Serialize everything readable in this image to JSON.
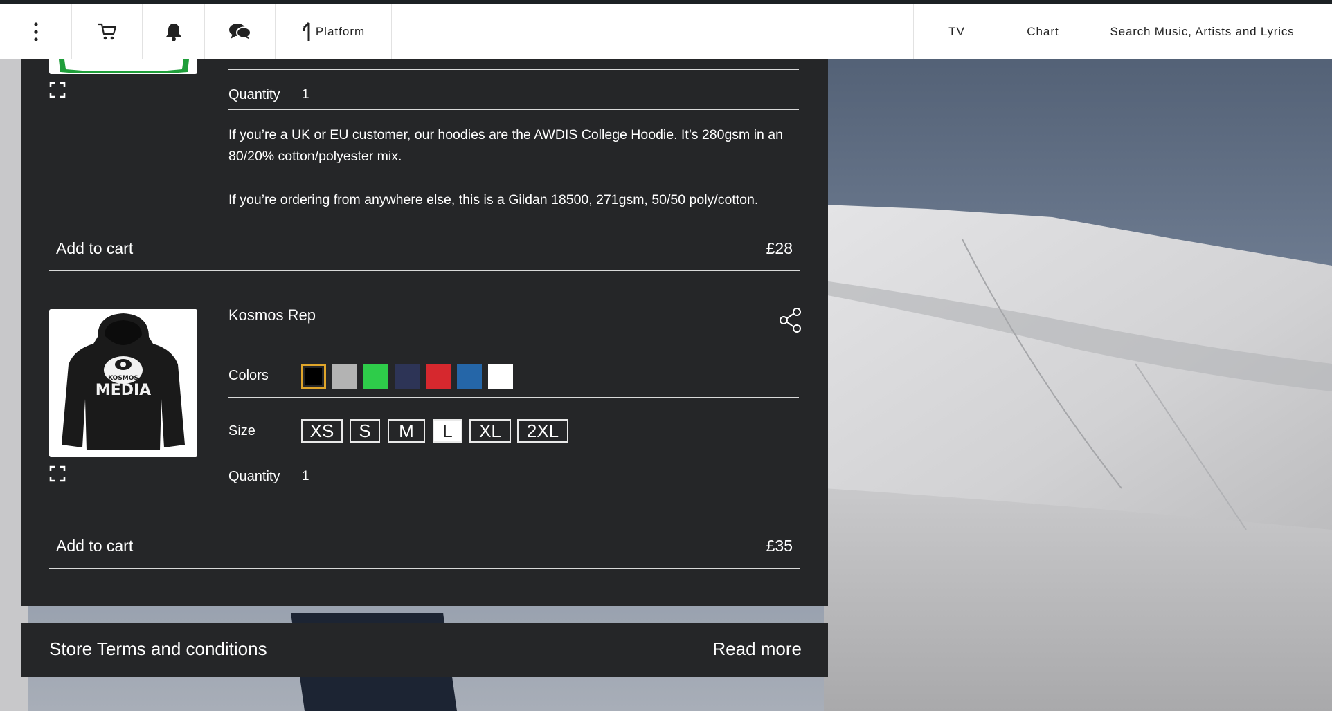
{
  "topbar": {
    "platform_label": "Platform",
    "tv_label": "TV",
    "chart_label": "Chart",
    "search_placeholder": "Search Music, Artists and Lyrics"
  },
  "product_prev": {
    "quantity_label": "Quantity",
    "quantity_value": "1",
    "description_1": "If you’re a UK or EU customer, our hoodies are the AWDIS College Hoodie. It’s 280gsm in an 80/20% cotton/polyester mix.",
    "description_2": "If you’re ordering from anywhere else, this is a Gildan 18500, 271gsm, 50/50 poly/cotton.",
    "add_to_cart": "Add to cart",
    "price": "£28"
  },
  "product": {
    "title": "Kosmos Rep",
    "image_text_top": "KOSMOS",
    "image_text_main": "MEDIA",
    "colors_label": "Colors",
    "colors": [
      "#000000",
      "#b3b3b3",
      "#2ecc4a",
      "#2d3456",
      "#d6282e",
      "#2566a8",
      "#ffffff"
    ],
    "selected_color_border": "#e0a52a",
    "size_label": "Size",
    "sizes": [
      "XS",
      "S",
      "M",
      "L",
      "XL",
      "2XL"
    ],
    "selected_size": "L",
    "quantity_label": "Quantity",
    "quantity_value": "1",
    "add_to_cart": "Add to cart",
    "price": "£35"
  },
  "terms": {
    "title": "Store Terms and conditions",
    "read_more": "Read more"
  }
}
